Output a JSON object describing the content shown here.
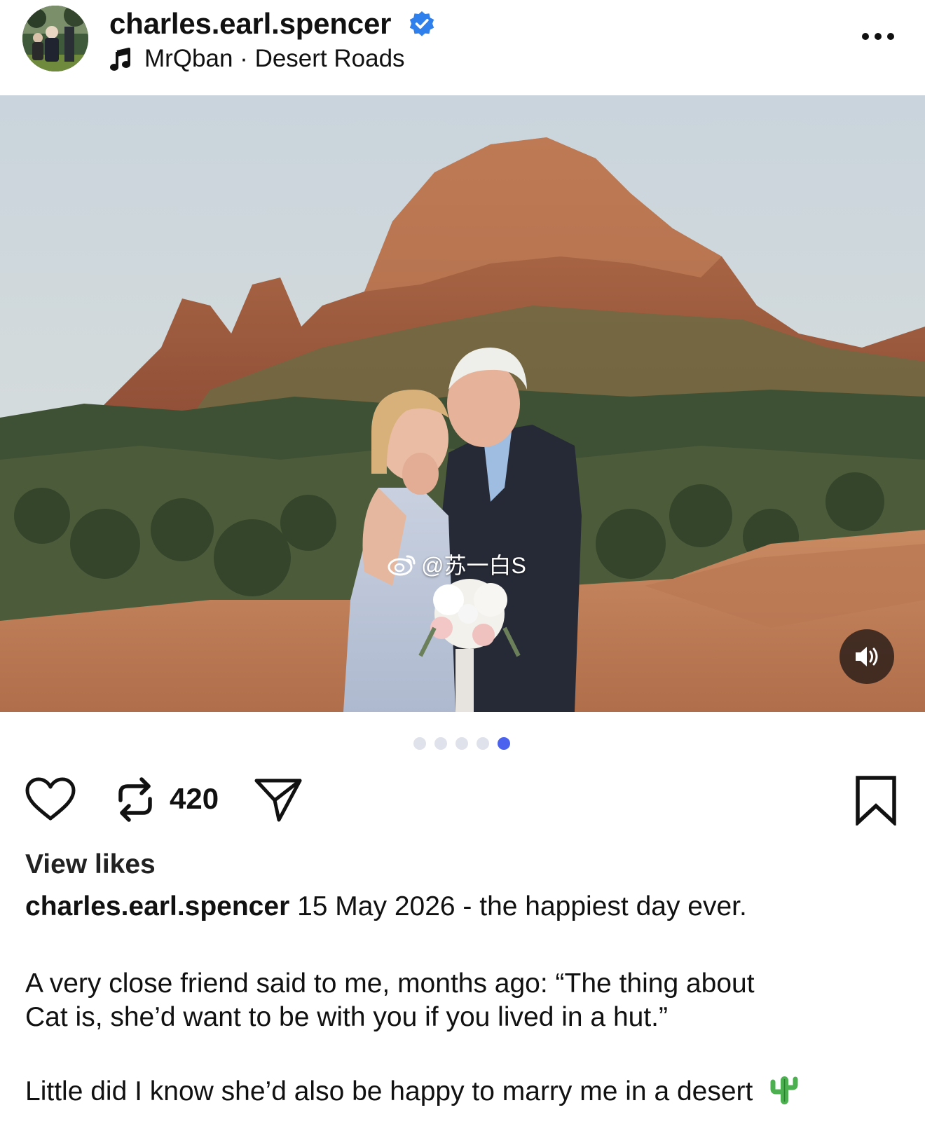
{
  "post": {
    "username": "charles.earl.spencer",
    "verified": true,
    "music_artist": "MrQban",
    "music_separator": "·",
    "music_track": "Desert Roads"
  },
  "media": {
    "watermark": "@苏一白S",
    "carousel_total": 5,
    "carousel_active": 5
  },
  "actions": {
    "repost_count": "420"
  },
  "caption": {
    "view_likes": "View likes",
    "username": "charles.earl.spencer",
    "text": "15 May 2026 - the happiest day ever.",
    "paragraph_1_line_1": "A very close friend said to me, months ago: “The thing about",
    "paragraph_1_line_2": "Cat is, she’d want to be with you if you lived in a hut.”",
    "paragraph_2": "Little did I know she’d also be happy to marry me in a desert",
    "paragraph_2_emoji": "cactus-emoji"
  },
  "colors": {
    "verified_blue": "#2f80ed",
    "active_dot": "#4a62ee",
    "inactive_dot": "#dfe2ea"
  }
}
